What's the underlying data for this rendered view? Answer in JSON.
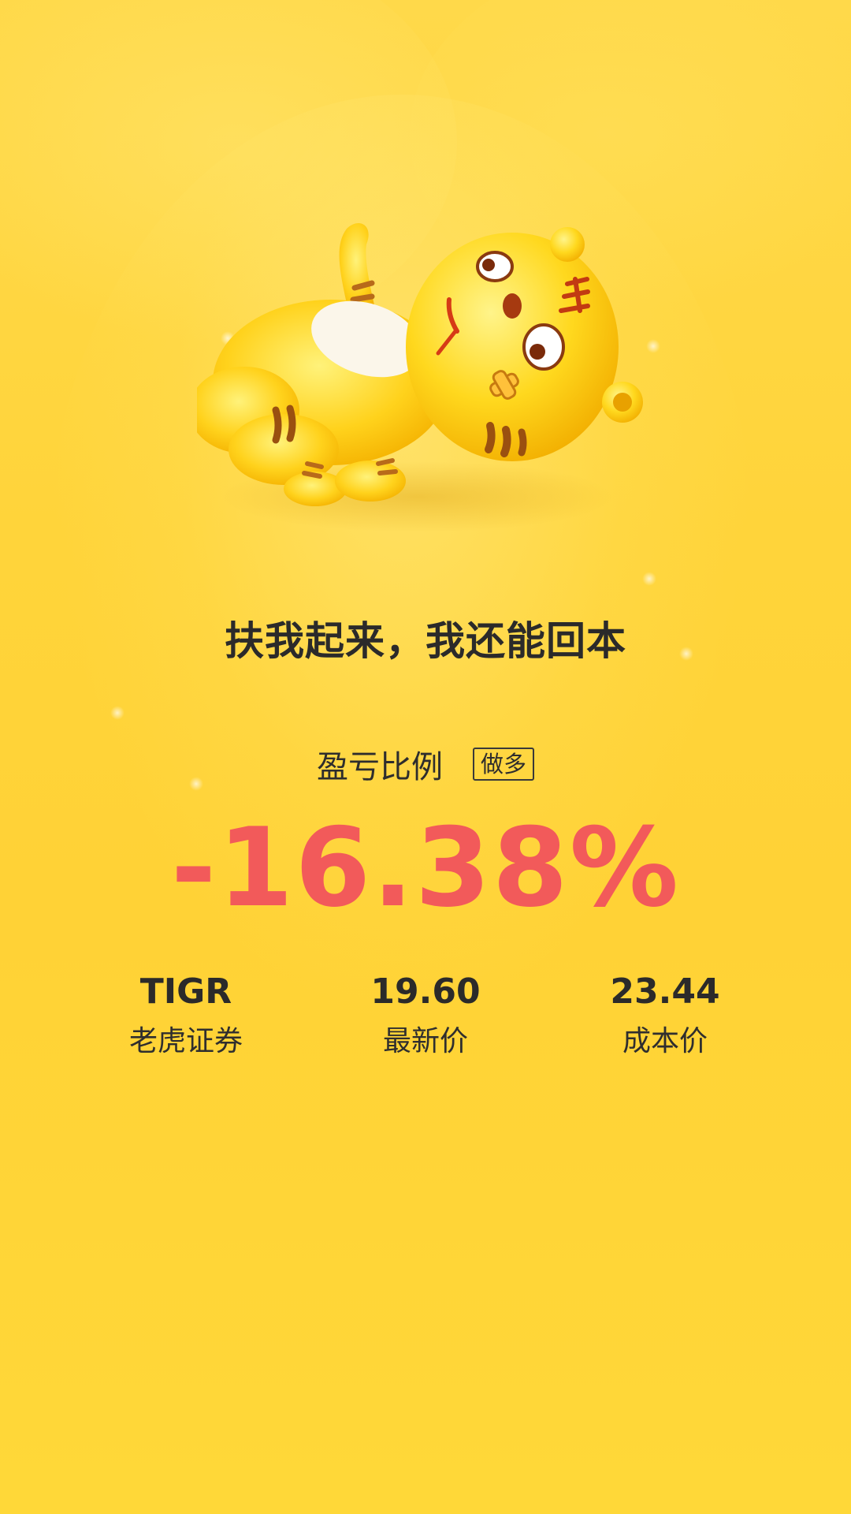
{
  "headline": "扶我起来，我还能回本",
  "ratio": {
    "label": "盈亏比例",
    "direction_badge": "做多",
    "value": "-16.38%"
  },
  "stats": [
    {
      "value": "TIGR",
      "label": "老虎证券"
    },
    {
      "value": "19.60",
      "label": "最新价"
    },
    {
      "value": "23.44",
      "label": "成本价"
    }
  ],
  "colors": {
    "background": "#ffd43a",
    "loss_red": "#f25a5a",
    "text_dark": "#2b2a2a"
  },
  "mascot": "fallen-tiger-mascot-illustration"
}
